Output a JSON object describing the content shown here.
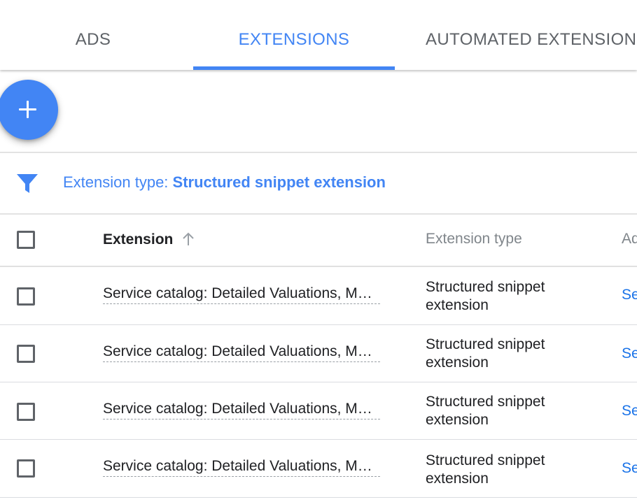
{
  "tabs": [
    {
      "label": "ADS",
      "active": false
    },
    {
      "label": "EXTENSIONS",
      "active": true
    },
    {
      "label": "AUTOMATED EXTENSIONS",
      "active": false
    }
  ],
  "fab": {
    "icon": "plus-icon"
  },
  "filter": {
    "icon": "filter-icon",
    "label": "Extension type: ",
    "value": "Structured snippet extension"
  },
  "table": {
    "headers": {
      "extension": "Extension",
      "extension_type": "Extension type",
      "added_to": "Ad"
    },
    "sort": {
      "column": "extension",
      "direction": "ascending",
      "icon": "arrow-up-icon"
    },
    "rows": [
      {
        "extension": "Service catalog: Detailed Valuations, M…",
        "type": "Structured snippet extension",
        "link": "Se"
      },
      {
        "extension": "Service catalog: Detailed Valuations, M…",
        "type": "Structured snippet extension",
        "link": "Se"
      },
      {
        "extension": "Service catalog: Detailed Valuations, M…",
        "type": "Structured snippet extension",
        "link": "Se"
      },
      {
        "extension": "Service catalog: Detailed Valuations, M…",
        "type": "Structured snippet extension",
        "link": "Se"
      }
    ]
  },
  "colors": {
    "accent": "#4285f4",
    "link": "#1a73e8",
    "text": "#202124",
    "muted": "#5f6368"
  }
}
